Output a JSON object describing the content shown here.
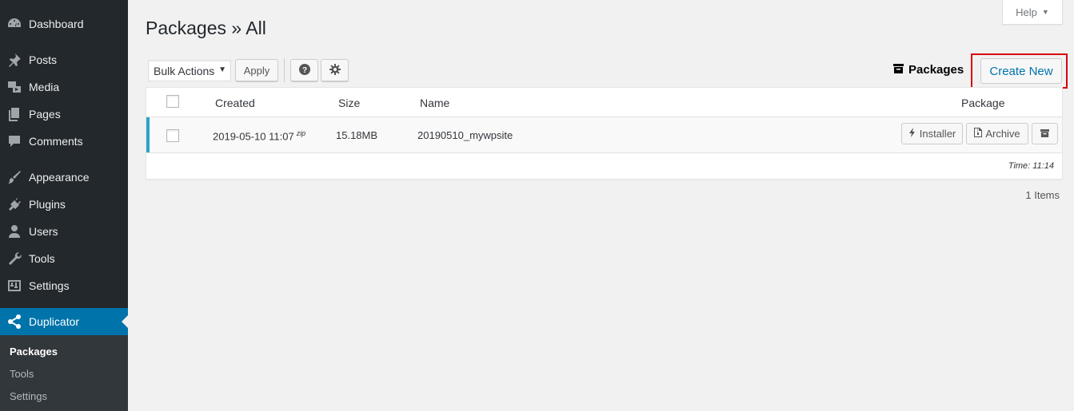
{
  "sidebar": {
    "items": [
      {
        "label": "Dashboard",
        "icon": "dashboard-icon"
      },
      {
        "label": "Posts",
        "icon": "pin-icon"
      },
      {
        "label": "Media",
        "icon": "media-icon"
      },
      {
        "label": "Pages",
        "icon": "pages-icon"
      },
      {
        "label": "Comments",
        "icon": "comment-icon"
      },
      {
        "label": "Appearance",
        "icon": "brush-icon"
      },
      {
        "label": "Plugins",
        "icon": "plugin-icon"
      },
      {
        "label": "Users",
        "icon": "user-icon"
      },
      {
        "label": "Tools",
        "icon": "wrench-icon"
      },
      {
        "label": "Settings",
        "icon": "sliders-icon"
      },
      {
        "label": "Duplicator",
        "icon": "share-icon"
      }
    ],
    "submenu": [
      "Packages",
      "Tools",
      "Settings"
    ],
    "accent_color": "#0073aa"
  },
  "help": {
    "label": "Help",
    "caret": "▼"
  },
  "page": {
    "title": "Packages » All"
  },
  "toolbar": {
    "bulk_actions": "Bulk Actions",
    "bulk_caret": "▼",
    "apply": "Apply",
    "help_icon": "question-circle-icon",
    "settings_icon": "gear-icon",
    "packages_label": "Packages",
    "create_new": "Create New"
  },
  "table": {
    "headers": {
      "created": "Created",
      "size": "Size",
      "name": "Name",
      "package": "Package"
    },
    "rows": [
      {
        "created": "2019-05-10 11:07",
        "format": "zip",
        "size": "15.18MB",
        "name": "20190510_mywpsite",
        "installer_label": "Installer",
        "archive_label": "Archive"
      }
    ],
    "footer_time": "Time: 11:14",
    "row_accent_color": "#2ea2cc"
  },
  "items_count": "1 Items",
  "highlight_color": "#d9000d"
}
